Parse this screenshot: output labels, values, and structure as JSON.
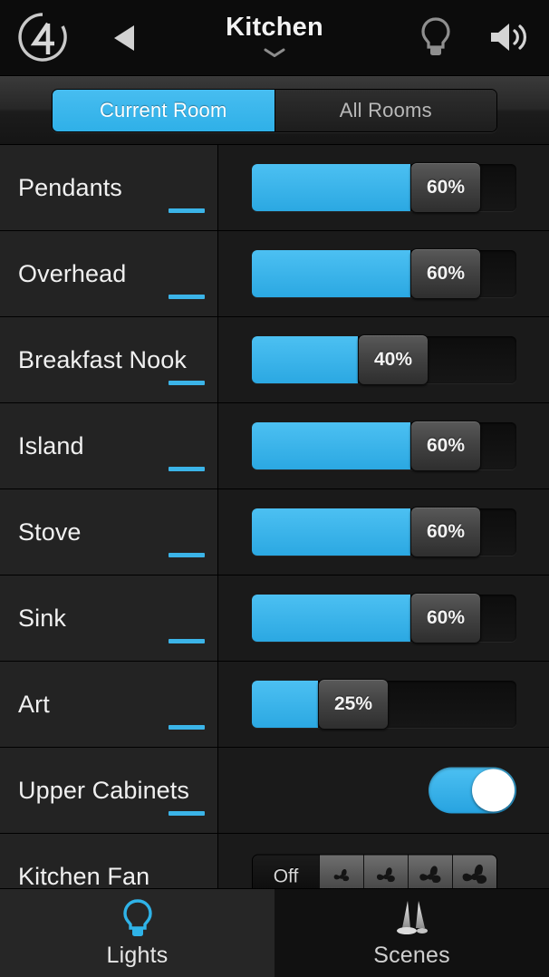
{
  "header": {
    "logo_icon": "control4-logo-icon",
    "back_icon": "back-arrow-icon",
    "title": "Kitchen",
    "chevron_icon": "chevron-down-icon",
    "bulb_icon": "lightbulb-icon",
    "speaker_icon": "speaker-volume-icon"
  },
  "room_scope": {
    "options": [
      {
        "label": "Current Room",
        "active": true
      },
      {
        "label": "All Rooms",
        "active": false
      }
    ]
  },
  "lights": [
    {
      "name": "Pendants",
      "type": "dimmer",
      "value": "60%",
      "level": 60,
      "has_dash": true
    },
    {
      "name": "Overhead",
      "type": "dimmer",
      "value": "60%",
      "level": 60,
      "has_dash": true
    },
    {
      "name": "Breakfast Nook",
      "type": "dimmer",
      "value": "40%",
      "level": 40,
      "has_dash": true
    },
    {
      "name": "Island",
      "type": "dimmer",
      "value": "60%",
      "level": 60,
      "has_dash": true
    },
    {
      "name": "Stove",
      "type": "dimmer",
      "value": "60%",
      "level": 60,
      "has_dash": true
    },
    {
      "name": "Sink",
      "type": "dimmer",
      "value": "60%",
      "level": 60,
      "has_dash": true
    },
    {
      "name": "Art",
      "type": "dimmer",
      "value": "25%",
      "level": 25,
      "has_dash": true
    },
    {
      "name": "Upper Cabinets",
      "type": "switch",
      "switch_on": true,
      "has_dash": true
    },
    {
      "name": "Kitchen Fan",
      "type": "fan",
      "off_label": "Off",
      "selected": "Off",
      "speeds": [
        "fan-speed-1-icon",
        "fan-speed-2-icon",
        "fan-speed-3-icon",
        "fan-speed-4-icon"
      ],
      "has_dash": false
    }
  ],
  "tabbar": {
    "tabs": [
      {
        "label": "Lights",
        "icon": "lightbulb-icon",
        "active": true
      },
      {
        "label": "Scenes",
        "icon": "spotlight-beams-icon",
        "active": false
      }
    ]
  },
  "colors": {
    "accent_blue": "#3bb4e8",
    "row_bg": "#232323",
    "panel_bg": "#1a1a1a",
    "text": "#f0f0f0"
  }
}
